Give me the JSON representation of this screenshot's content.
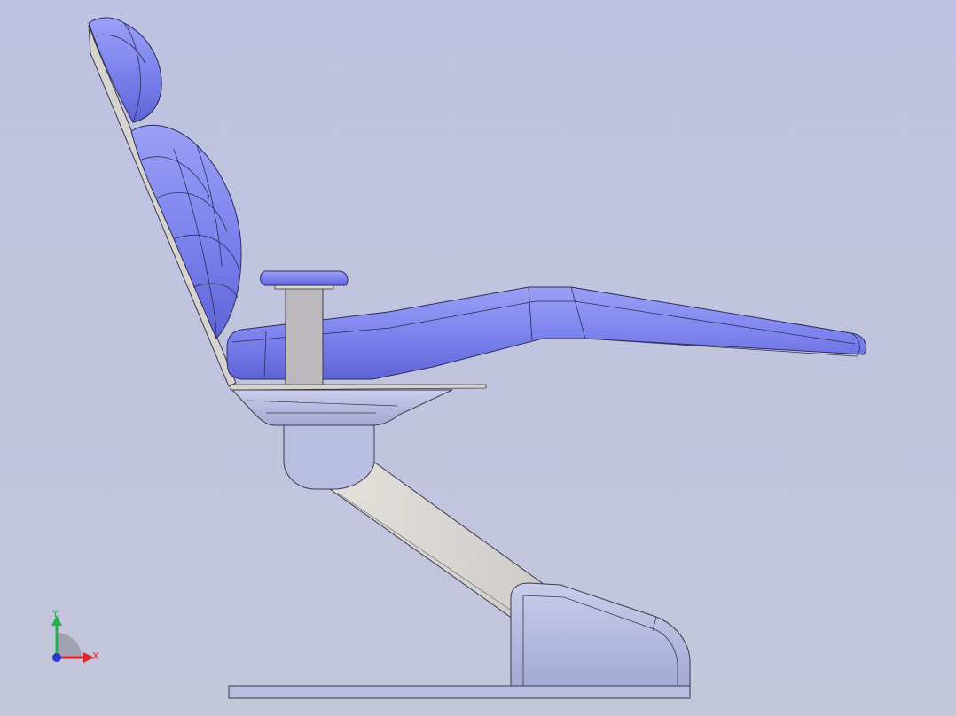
{
  "viewport": {
    "background_top": "#bfc3e1",
    "background_bottom": "#c4c7da"
  },
  "model": {
    "parts": [
      {
        "name": "headrest",
        "color": "#7d83ea"
      },
      {
        "name": "backrest",
        "color": "#7d83ea"
      },
      {
        "name": "back-plate",
        "color": "#d7d3cf"
      },
      {
        "name": "armrest",
        "color": "#b9b6ba"
      },
      {
        "name": "seat-leg-cushion",
        "color": "#7d83ea"
      },
      {
        "name": "seat-frame",
        "color": "#b9bde0"
      },
      {
        "name": "pivot-housing",
        "color": "#b9bde0"
      },
      {
        "name": "lift-arm",
        "color": "#d8d5d2"
      },
      {
        "name": "base-housing",
        "color": "#b9bde0"
      },
      {
        "name": "floor-plate",
        "color": "#b9bde0"
      }
    ]
  },
  "triad": {
    "x_label": "X",
    "y_label": "Y",
    "x_color": "#e0262c",
    "y_color": "#26b24a",
    "z_color": "#2936c8"
  }
}
